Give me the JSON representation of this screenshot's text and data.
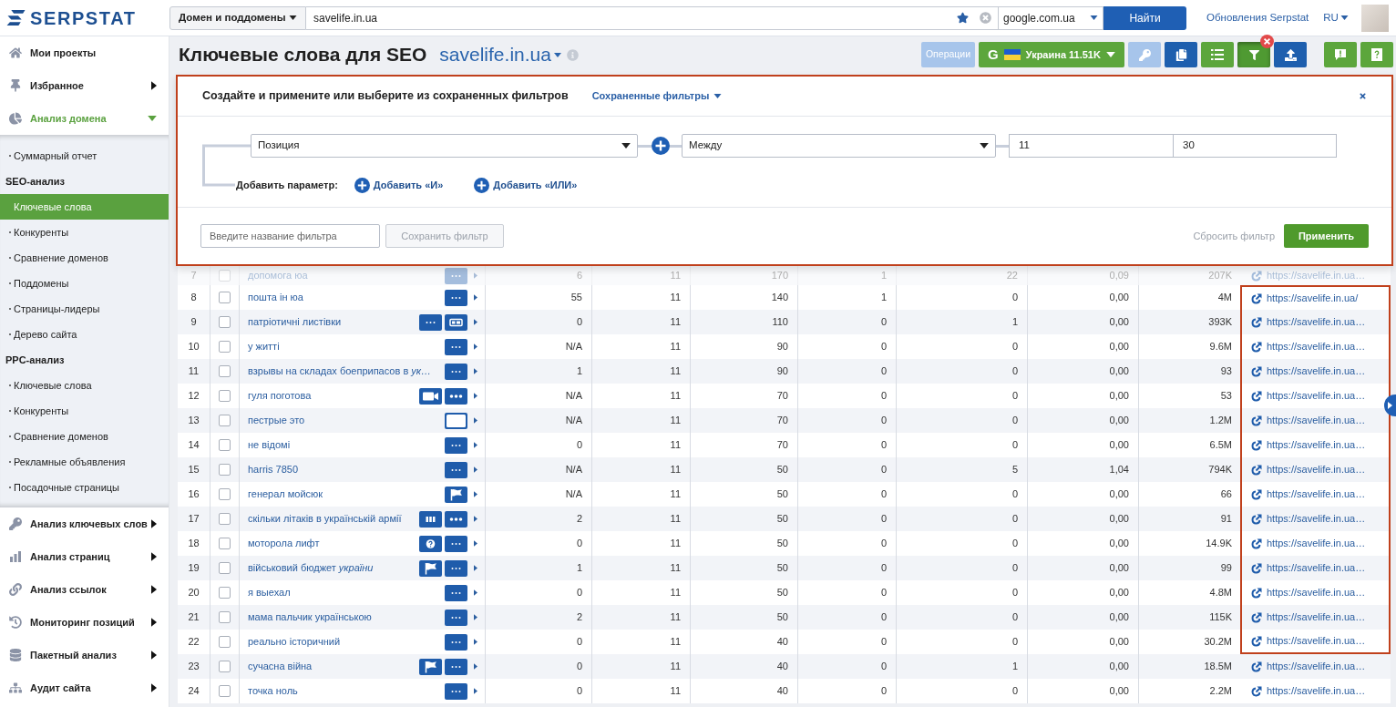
{
  "top_bar": {
    "logo": "SERPSTAT",
    "scope": "Домен и поддомены",
    "query": "savelife.in.ua",
    "engine": "google.com.ua",
    "search_button": "Найти",
    "updates": "Обновления Serpstat",
    "language": "RU"
  },
  "sidebar": {
    "items": [
      {
        "label": "Мои проекты",
        "kind": "link"
      },
      {
        "label": "Избранное",
        "kind": "menu",
        "expanded": false
      },
      {
        "label": "Анализ домена",
        "kind": "menu",
        "expanded": true,
        "children": [
          {
            "label": "Суммарный отчет",
            "kind": "link",
            "selected": false
          },
          {
            "label": "SEO-анализ",
            "kind": "section",
            "children": [
              {
                "label": "Ключевые слова",
                "selected": true
              },
              {
                "label": "Конкуренты",
                "selected": false
              },
              {
                "label": "Сравнение доменов",
                "selected": false
              },
              {
                "label": "Поддомены",
                "selected": false
              },
              {
                "label": "Страницы-лидеры",
                "selected": false
              },
              {
                "label": "Дерево сайта",
                "selected": false
              }
            ]
          },
          {
            "label": "PPC-анализ",
            "kind": "section",
            "children": [
              {
                "label": "Ключевые слова",
                "selected": false
              },
              {
                "label": "Конкуренты",
                "selected": false
              },
              {
                "label": "Сравнение доменов",
                "selected": false
              },
              {
                "label": "Рекламные объявления",
                "selected": false
              },
              {
                "label": "Посадочные страницы",
                "selected": false
              }
            ]
          }
        ]
      },
      {
        "label": "Анализ ключевых слов",
        "kind": "menu",
        "expanded": false
      },
      {
        "label": "Анализ страниц",
        "kind": "menu",
        "expanded": false
      },
      {
        "label": "Анализ ссылок",
        "kind": "menu",
        "expanded": false
      },
      {
        "label": "Мониторинг позиций",
        "kind": "menu",
        "expanded": false
      },
      {
        "label": "Пакетный анализ",
        "kind": "menu",
        "expanded": false
      },
      {
        "label": "Аудит сайта",
        "kind": "menu",
        "expanded": false
      }
    ]
  },
  "page": {
    "title": "Ключевые слова для SEO",
    "domain": "savelife.in.ua"
  },
  "toolbar": [
    {
      "kind": "operations",
      "label": "Операции",
      "color": "#a7c5eb"
    },
    {
      "kind": "region",
      "engine_mark": "G",
      "label": "Украина 11.51K",
      "color": "#5ca63c"
    },
    {
      "kind": "key",
      "color": "#a7c5eb"
    },
    {
      "kind": "copy",
      "color": "#1e5fae"
    },
    {
      "kind": "columns",
      "color": "#5ca63c"
    },
    {
      "kind": "filter",
      "color": "#4f9a32",
      "active": true
    },
    {
      "kind": "export",
      "color": "#1e5fae"
    }
  ],
  "help_buttons": [
    {
      "kind": "report",
      "color": "#5ca63c"
    },
    {
      "kind": "help",
      "color": "#5ca63c"
    }
  ],
  "filter_panel": {
    "highlighted": true,
    "title": "Создайте и примените или выберите из сохраненных фильтров",
    "saved_filters": "Сохраненные фильтры",
    "condition": {
      "parameter": "Позиция",
      "operator": "Между",
      "from": "11",
      "to": "30"
    },
    "add_label": "Добавить параметр:",
    "add_and": "Добавить «И»",
    "add_or": "Добавить «ИЛИ»",
    "name_placeholder": "Введите название фильтра",
    "save_button": {
      "label": "Сохранить фильтр",
      "disabled": true
    },
    "reset_link": "Сбросить фильтр",
    "apply_button": "Применить"
  },
  "table": {
    "rows": [
      {
        "number": "7",
        "checked": false,
        "keyword": "допомога юа",
        "features": [
          {
            "kind": "dots"
          }
        ],
        "values": [
          "6",
          "11",
          "170",
          "1",
          "22",
          "0,09",
          "207K"
        ],
        "url": "https://savelife.in.ua…",
        "highlighted": false
      },
      {
        "number": "8",
        "checked": false,
        "keyword": "пошта ін юа",
        "features": [
          {
            "kind": "dots"
          }
        ],
        "values": [
          "55",
          "11",
          "140",
          "1",
          "0",
          "0,00",
          "4M"
        ],
        "url": "https://savelife.in.ua/",
        "highlighted": true
      },
      {
        "number": "9",
        "checked": false,
        "keyword": "патріотичні листівки",
        "features": [
          {
            "kind": "dots"
          },
          {
            "kind": "card"
          }
        ],
        "values": [
          "0",
          "11",
          "110",
          "0",
          "1",
          "0,00",
          "393K"
        ],
        "url": "https://savelife.in.ua…",
        "highlighted": true
      },
      {
        "number": "10",
        "checked": false,
        "keyword": "у житті",
        "features": [
          {
            "kind": "dots"
          }
        ],
        "values": [
          "N/A",
          "11",
          "90",
          "0",
          "0",
          "0,00",
          "9.6M"
        ],
        "url": "https://savelife.in.ua…",
        "highlighted": true
      },
      {
        "number": "11",
        "checked": false,
        "keyword": "взрывы на складах боеприпасов в *ук…*",
        "features": [
          {
            "kind": "dots"
          }
        ],
        "values": [
          "1",
          "11",
          "90",
          "0",
          "0",
          "0,00",
          "93"
        ],
        "url": "https://savelife.in.ua…",
        "highlighted": true
      },
      {
        "number": "12",
        "checked": false,
        "keyword": "гуля поготова",
        "features": [
          {
            "kind": "video"
          },
          {
            "kind": "dots-bold"
          }
        ],
        "values": [
          "N/A",
          "11",
          "70",
          "0",
          "0",
          "0,00",
          "53"
        ],
        "url": "https://savelife.in.ua…",
        "highlighted": true
      },
      {
        "number": "13",
        "checked": false,
        "keyword": "пестрые это",
        "features": [
          {
            "kind": "blank"
          }
        ],
        "values": [
          "N/A",
          "11",
          "70",
          "0",
          "0",
          "0,00",
          "1.2M"
        ],
        "url": "https://savelife.in.ua…",
        "highlighted": true
      },
      {
        "number": "14",
        "checked": false,
        "keyword": "не відомі",
        "features": [
          {
            "kind": "dots"
          }
        ],
        "values": [
          "0",
          "11",
          "70",
          "0",
          "0",
          "0,00",
          "6.5M"
        ],
        "url": "https://savelife.in.ua…",
        "highlighted": true
      },
      {
        "number": "15",
        "checked": false,
        "keyword": "harris 7850",
        "features": [
          {
            "kind": "dots"
          }
        ],
        "values": [
          "N/A",
          "11",
          "50",
          "0",
          "5",
          "1,04",
          "794K"
        ],
        "url": "https://savelife.in.ua…",
        "highlighted": true
      },
      {
        "number": "16",
        "checked": false,
        "keyword": "генерал мойсюк",
        "features": [
          {
            "kind": "flag"
          }
        ],
        "values": [
          "N/A",
          "11",
          "50",
          "0",
          "0",
          "0,00",
          "66"
        ],
        "url": "https://savelife.in.ua…",
        "highlighted": true
      },
      {
        "number": "17",
        "checked": false,
        "keyword": "скільки літаків в українській армії",
        "features": [
          {
            "kind": "bars"
          },
          {
            "kind": "dots-bold"
          }
        ],
        "values": [
          "2",
          "11",
          "50",
          "0",
          "0",
          "0,00",
          "91"
        ],
        "url": "https://savelife.in.ua…",
        "highlighted": true
      },
      {
        "number": "18",
        "checked": false,
        "keyword": "моторола лифт",
        "features": [
          {
            "kind": "question"
          },
          {
            "kind": "dots"
          }
        ],
        "values": [
          "0",
          "11",
          "50",
          "0",
          "0",
          "0,00",
          "14.9K"
        ],
        "url": "https://savelife.in.ua…",
        "highlighted": true
      },
      {
        "number": "19",
        "checked": false,
        "keyword": "військовий бюджет *україни*",
        "features": [
          {
            "kind": "flag"
          },
          {
            "kind": "dots"
          }
        ],
        "values": [
          "1",
          "11",
          "50",
          "0",
          "0",
          "0,00",
          "99"
        ],
        "url": "https://savelife.in.ua…",
        "highlighted": true
      },
      {
        "number": "20",
        "checked": false,
        "keyword": "я выехал",
        "features": [
          {
            "kind": "dots"
          }
        ],
        "values": [
          "0",
          "11",
          "50",
          "0",
          "0",
          "0,00",
          "4.8M"
        ],
        "url": "https://savelife.in.ua…",
        "highlighted": true
      },
      {
        "number": "21",
        "checked": false,
        "keyword": "мама пальчик українською",
        "features": [
          {
            "kind": "dots"
          }
        ],
        "values": [
          "2",
          "11",
          "50",
          "0",
          "0",
          "0,00",
          "115K"
        ],
        "url": "https://savelife.in.ua…",
        "highlighted": true
      },
      {
        "number": "22",
        "checked": false,
        "keyword": "реально історичний",
        "features": [
          {
            "kind": "dots"
          }
        ],
        "values": [
          "0",
          "11",
          "40",
          "0",
          "0",
          "0,00",
          "30.2M"
        ],
        "url": "https://savelife.in.ua…",
        "highlighted": true
      },
      {
        "number": "23",
        "checked": false,
        "keyword": "сучасна війна",
        "features": [
          {
            "kind": "flag"
          },
          {
            "kind": "dots"
          }
        ],
        "values": [
          "0",
          "11",
          "40",
          "0",
          "1",
          "0,00",
          "18.5M"
        ],
        "url": "https://savelife.in.ua…",
        "highlighted": false
      },
      {
        "number": "24",
        "checked": false,
        "keyword": "точка ноль",
        "features": [
          {
            "kind": "dots"
          }
        ],
        "values": [
          "0",
          "11",
          "40",
          "0",
          "0",
          "0,00",
          "2.2M"
        ],
        "url": "https://savelife.in.ua…",
        "highlighted": false
      }
    ]
  }
}
